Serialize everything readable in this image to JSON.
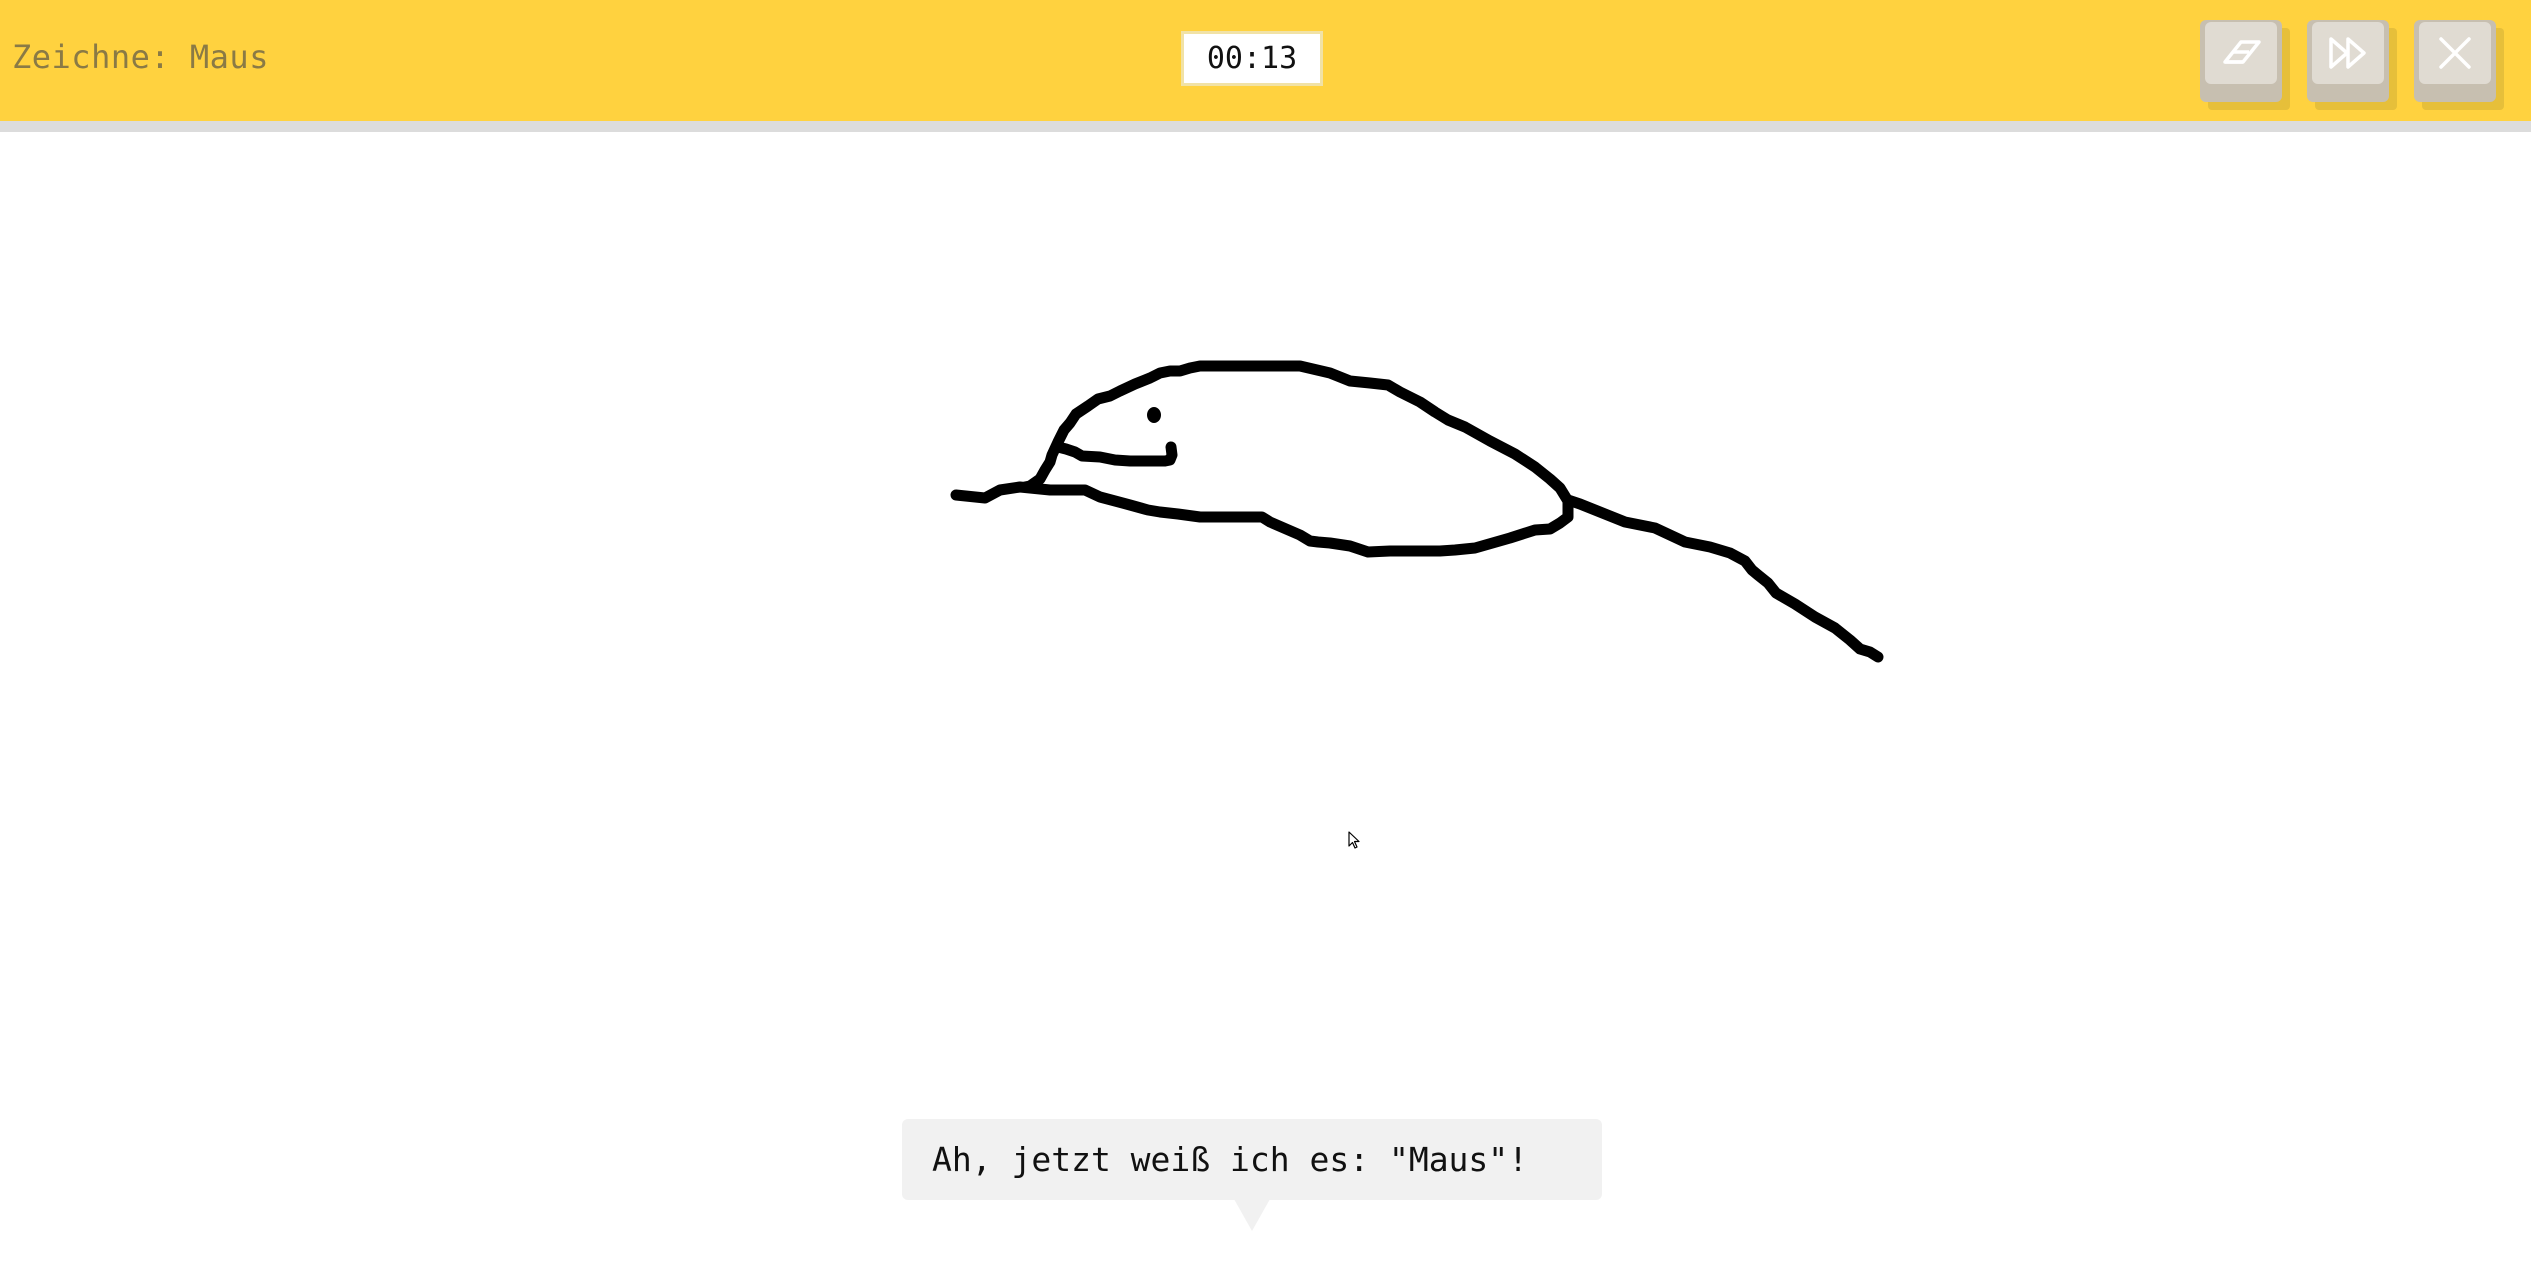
{
  "header": {
    "prompt_text": "Zeichne: Maus",
    "timer": "00:13",
    "accent_color": "#ffd23f",
    "buttons": [
      {
        "icon": "eraser-icon",
        "action": "clear-drawing"
      },
      {
        "icon": "fast-forward-icon",
        "action": "skip"
      },
      {
        "icon": "close-icon",
        "action": "close"
      }
    ]
  },
  "canvas": {
    "stroke_color": "#000000",
    "cursor_icon": "mouse-pointer-icon"
  },
  "speech_bubble": {
    "text": "Ah, jetzt weiß ich es: \"Maus\"!"
  }
}
